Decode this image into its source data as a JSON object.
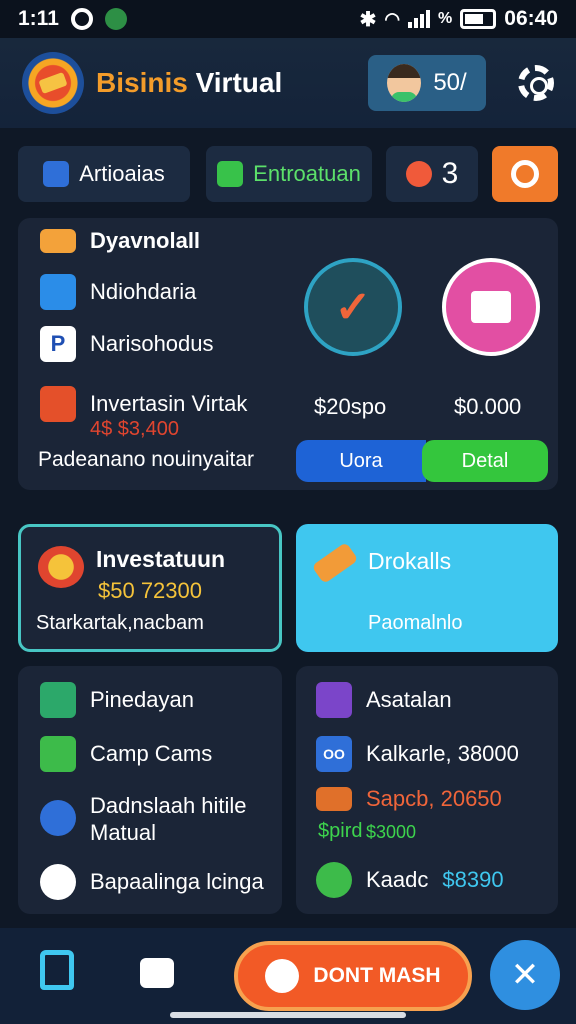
{
  "status_bar": {
    "time": "1:11",
    "clock_right": "06:40"
  },
  "header": {
    "brand_part1": "Bisinis",
    "brand_part2": "Virtual",
    "coins": "50/"
  },
  "tabs": [
    {
      "label": "Artioaias"
    },
    {
      "label": "Entroatuan"
    },
    {
      "label": "3"
    }
  ],
  "top_panel": {
    "items": [
      {
        "label": "Dyavnolall"
      },
      {
        "label": "Ndiohdaria"
      },
      {
        "label": "Narisohodus"
      },
      {
        "label": "Invertasin Virtak",
        "sub": "4$ $3,400"
      }
    ],
    "footer": "Padeanano nouinyaitar",
    "stats": [
      {
        "value": "$20spo"
      },
      {
        "value": "$0.000"
      }
    ],
    "buttons": [
      {
        "label": "Uora"
      },
      {
        "label": "Detal"
      }
    ]
  },
  "invest_card": {
    "title": "Investatuun",
    "amount": "$50 72300",
    "caption": "Starkartak,nacbam"
  },
  "drokalls_card": {
    "title": "Drokalls",
    "caption": "Paomalnlo"
  },
  "left_list": [
    {
      "label": "Pinedayan"
    },
    {
      "label": "Camp Cams"
    },
    {
      "label": "Dadnslaah hitile Matual"
    },
    {
      "label": "Bapaalinga lcinga"
    }
  ],
  "right_list": [
    {
      "label": "Asatalan"
    },
    {
      "label": "Kalkarle, 38000"
    },
    {
      "label": "Sapcb, 20650",
      "sub1": "$pird",
      "sub2": "$3000"
    },
    {
      "label": "Kaadc",
      "value": "$8390"
    }
  ],
  "bottom_nav": {
    "cta": "DONT MASH"
  },
  "colors": {
    "accent_orange": "#f39c2a",
    "panel": "#1b2537",
    "blue_button": "#1e63d6",
    "green_button": "#34c63d",
    "cyan_card": "#3fc7ef"
  }
}
